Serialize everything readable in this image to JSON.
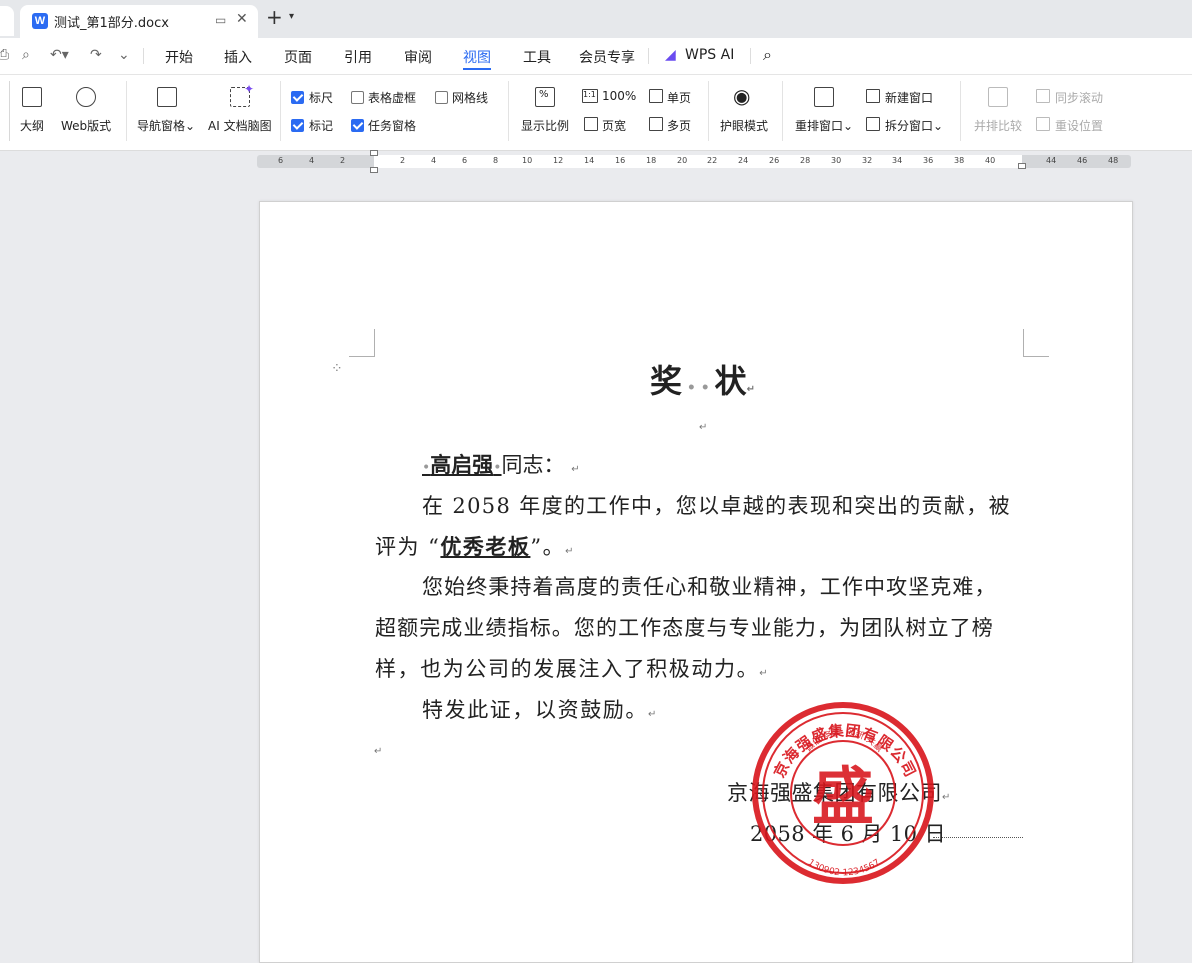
{
  "tab": {
    "title": "测试_第1部分.docx",
    "app_letter": "W"
  },
  "menu": {
    "items": [
      "开始",
      "插入",
      "页面",
      "引用",
      "审阅",
      "视图",
      "工具",
      "会员专享",
      "WPS AI"
    ],
    "active": "视图"
  },
  "ribbon": {
    "outline": "大纲",
    "web_layout": "Web版式",
    "nav_pane": "导航窗格",
    "ai_mindmap": "AI 文档脑图",
    "ruler": "标尺",
    "table_gridlines": "表格虚框",
    "gridlines": "网格线",
    "marks": "标记",
    "task_pane": "任务窗格",
    "zoom": "显示比例",
    "zoom_100_badge": "1:1",
    "zoom_100": "100%",
    "page_width": "页宽",
    "single_page": "单页",
    "multi_page": "多页",
    "eye_mode": "护眼模式",
    "arrange_windows": "重排窗口",
    "new_window": "新建窗口",
    "split_window": "拆分窗口",
    "side_by_side": "并排比较",
    "sync_scroll": "同步滚动",
    "reset_position": "重设位置",
    "checkboxes": {
      "ruler": true,
      "table_gridlines": false,
      "gridlines": false,
      "marks": true,
      "task_pane": true
    }
  },
  "ruler": {
    "numbers": [
      "6",
      "4",
      "2",
      "2",
      "4",
      "6",
      "8",
      "10",
      "12",
      "14",
      "16",
      "18",
      "20",
      "22",
      "24",
      "26",
      "28",
      "30",
      "32",
      "34",
      "36",
      "38",
      "40",
      "44",
      "46",
      "48"
    ]
  },
  "document": {
    "title_a": "奖",
    "title_b": "状",
    "salutation_name": "高启强",
    "salutation_rest": "同志：",
    "p1_line1": "在 2058 年度的工作中，您以卓越的表现和突出的贡献，被",
    "p1_line2_a": "评为 “",
    "p1_line2_bold": "优秀老板",
    "p1_line2_b": "”。",
    "p2_line1": "您始终秉持着高度的责任心和敬业精神，工作中攻坚克难，",
    "p2_line2": "超额完成业绩指标。您的工作态度与专业能力，为团队树立了榜",
    "p2_line3": "样，也为公司的发展注入了积极动力。",
    "p3": "特发此证，以资鼓励。",
    "company": "京海强盛集团有限公司",
    "date": "2058 年 6 月 10 日",
    "para_mark": "↵"
  },
  "seal": {
    "outer_text": "京海强盛集团有限公司",
    "top_text": "诚信 务实 创新 共赢",
    "center_char": "盛",
    "number": "130902 1234567",
    "color": "#d8141b"
  },
  "colors": {
    "accent": "#2b6bf2",
    "seal": "#d8141b"
  }
}
